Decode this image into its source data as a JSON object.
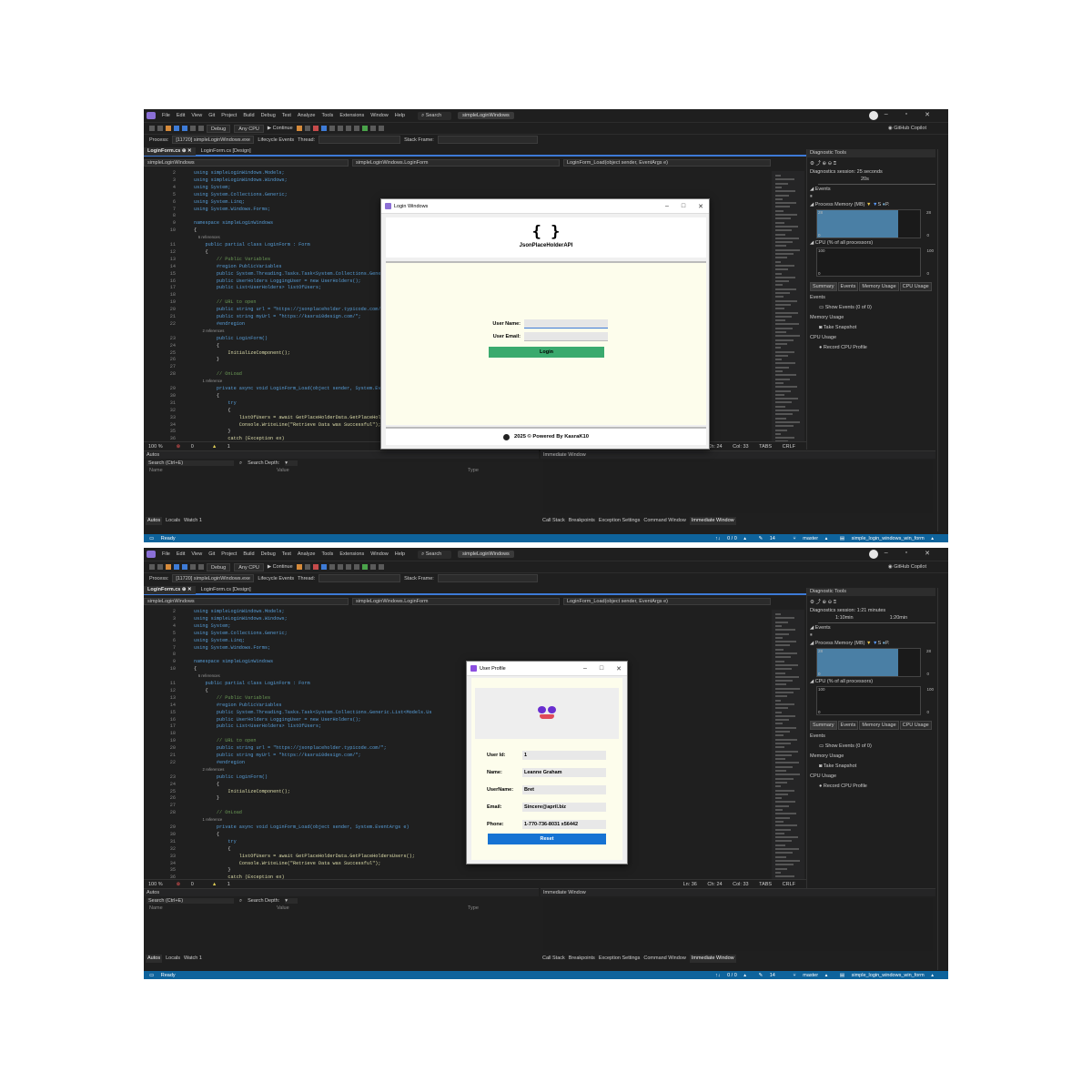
{
  "menu": [
    "File",
    "Edit",
    "View",
    "Git",
    "Project",
    "Build",
    "Debug",
    "Test",
    "Analyze",
    "Tools",
    "Extensions",
    "Window",
    "Help"
  ],
  "search": "Search",
  "project_title": "simpleLoginWindows",
  "toolbar": {
    "config": "Debug",
    "platform": "Any CPU",
    "continue": "Continue",
    "copilot": "GitHub Copilot"
  },
  "process_bar": {
    "label": "Process:",
    "process": "[11720] simpleLoginWindows.exe",
    "lifecycle": "Lifecycle Events",
    "thread": "Thread:",
    "stack": "Stack Frame:"
  },
  "tabs": {
    "active": "LoginForm.cs",
    "other": "LoginForm.cs [Design]"
  },
  "nav": {
    "project": "simpleLoginWindows",
    "class": "simpleLoginWindows.LoginForm",
    "method": "LoginForm_Load(object sender, EventArgs e)"
  },
  "code": [
    {
      "n": "2",
      "t": "using simpleLoginWindows.Models;"
    },
    {
      "n": "3",
      "t": "using simpleLoginWindows.Windows;"
    },
    {
      "n": "4",
      "t": "using System;"
    },
    {
      "n": "5",
      "t": "using System.Collections.Generic;"
    },
    {
      "n": "6",
      "t": "using System.Linq;"
    },
    {
      "n": "7",
      "t": "using System.Windows.Forms;"
    },
    {
      "n": "8",
      "t": ""
    },
    {
      "n": "9",
      "t": "namespace simpleLoginWindows"
    },
    {
      "n": "10",
      "t": "{"
    },
    {
      "n": "",
      "t": "    6 references"
    },
    {
      "n": "11",
      "t": "    public partial class LoginForm : Form"
    },
    {
      "n": "12",
      "t": "    {"
    },
    {
      "n": "13",
      "t": "        // Public Variables"
    },
    {
      "n": "14",
      "t": "        #region PublicVariables"
    },
    {
      "n": "15",
      "t": "        public System.Threading.Tasks.Task<System.Collections.Generic.List<Models.Us"
    },
    {
      "n": "16",
      "t": "        public UserHolders LoggingUser = new UserHolders();"
    },
    {
      "n": "17",
      "t": "        public List<UserHolders> listOfUsers;"
    },
    {
      "n": "18",
      "t": ""
    },
    {
      "n": "19",
      "t": "        // URL to open"
    },
    {
      "n": "20",
      "t": "        public string url = \"https://jsonplaceholder.typicode.com/\";"
    },
    {
      "n": "21",
      "t": "        public string myUrl = \"https://kasra10design.com/\";"
    },
    {
      "n": "22",
      "t": "        #endregion"
    },
    {
      "n": "",
      "t": "        2 references"
    },
    {
      "n": "23",
      "t": "        public LoginForm()"
    },
    {
      "n": "24",
      "t": "        {"
    },
    {
      "n": "25",
      "t": "            InitializeComponent();"
    },
    {
      "n": "26",
      "t": "        }"
    },
    {
      "n": "27",
      "t": ""
    },
    {
      "n": "28",
      "t": "        // OnLoad"
    },
    {
      "n": "",
      "t": "        1 reference"
    },
    {
      "n": "29",
      "t": "        private async void LoginForm_Load(object sender, System.EventArgs e)"
    },
    {
      "n": "30",
      "t": "        {"
    },
    {
      "n": "31",
      "t": "            try"
    },
    {
      "n": "32",
      "t": "            {"
    },
    {
      "n": "33",
      "t": "                listOfUsers = await GetPlaceHolderData.GetPlaceHoldersUsers();"
    },
    {
      "n": "34",
      "t": "                Console.WriteLine(\"Retrieve Data was Successful\");"
    },
    {
      "n": "35",
      "t": "            }"
    },
    {
      "n": "36",
      "t": "            catch (Exception ex)"
    }
  ],
  "editor_status": {
    "zoom": "100 %",
    "errors": "0",
    "warnings": "1",
    "ln": "Ln: 36",
    "ch": "Ch: 24",
    "col": "Col: 33",
    "tabs": "TABS",
    "crlf": "CRLF"
  },
  "diag": {
    "title": "Diagnostic Tools",
    "session1": "Diagnostics session: 25 seconds",
    "session2": "Diagnostics session: 1:21 minutes",
    "tick1": "20s",
    "tick2a": "1:10min",
    "tick2b": "1:20min",
    "events": "Events",
    "memory": "Process Memory (MB)",
    "mem_max": "28",
    "mem_min": "0",
    "cpu": "CPU (% of all processors)",
    "cpu_max": "100",
    "cpu_min": "0",
    "tabs": [
      "Summary",
      "Events",
      "Memory Usage",
      "CPU Usage"
    ],
    "ev_head": "Events",
    "show_events": "Show Events (0 of 0)",
    "mem_head": "Memory Usage",
    "snapshot": "Take Snapshot",
    "cpu_head": "CPU Usage",
    "record": "Record CPU Profile",
    "mem_fill1": 0.9,
    "mem_fill2": 0.9
  },
  "autos": {
    "title": "Autos",
    "search": "Search (Ctrl+E)",
    "depth": "Search Depth:",
    "cols": [
      "Name",
      "Value",
      "Type"
    ],
    "tabs": [
      "Autos",
      "Locals",
      "Watch 1"
    ]
  },
  "immediate": {
    "title": "Immediate Window",
    "tabs": [
      "Call Stack",
      "Breakpoints",
      "Exception Settings",
      "Command Window",
      "Immediate Window"
    ]
  },
  "status": {
    "ready": "Ready",
    "updown": "0 / 0",
    "pencil": "14",
    "branch": "master",
    "repo": "simple_login_windows_win_form"
  },
  "login": {
    "title": "Login Windows",
    "braces": "{ }",
    "api": "JsonPlaceHolderAPI",
    "user_name": "User Name:",
    "user_email": "User Email:",
    "button": "Login",
    "footer": "2025 © Powered By KasraK10"
  },
  "profile": {
    "title": "User Profile",
    "fields": [
      {
        "label": "User Id:",
        "value": "1"
      },
      {
        "label": "Name:",
        "value": "Leanne Graham"
      },
      {
        "label": "UserName:",
        "value": "Bret"
      },
      {
        "label": "Email:",
        "value": "Sincere@april.biz"
      },
      {
        "label": "Phone:",
        "value": "1-770-736-8031 x56442"
      }
    ],
    "button": "Reset"
  },
  "colors": {
    "accent": "#0e639c",
    "login_btn": "#3aaa6e",
    "reset_btn": "#1673d3",
    "form_bg": "#fdfdec"
  }
}
